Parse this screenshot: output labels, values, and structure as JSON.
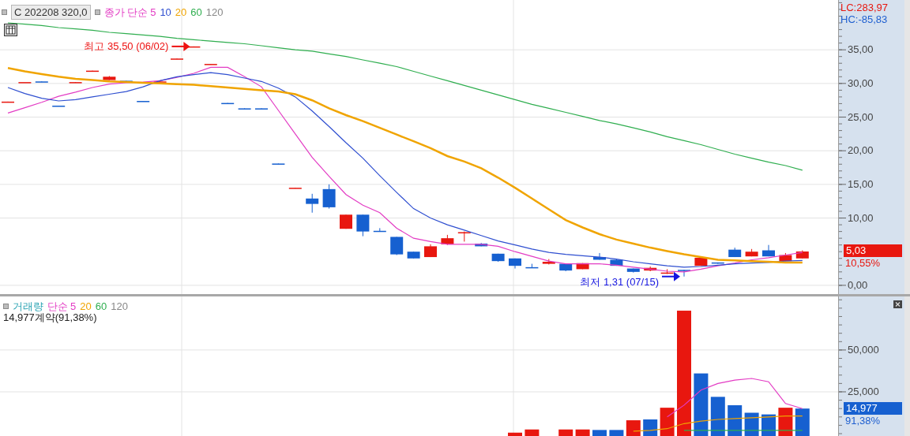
{
  "price_panel": {
    "symbol_box": "C 202208 320,0",
    "legend_prefix": "종가 단순",
    "legend_extra": "120",
    "lc": "LC:283,97",
    "hc": "HC:-85,83",
    "current_price_tag": "5,03",
    "current_change": "10,55%",
    "chart_data": {
      "type": "candlestick",
      "grid": true,
      "ylim": [
        -1.3,
        42.4
      ],
      "yticks": [
        {
          "value": 0,
          "label": "0,00"
        },
        {
          "value": 10,
          "label": "10,00"
        },
        {
          "value": 15,
          "label": "15,00"
        },
        {
          "value": 20,
          "label": "20,00"
        },
        {
          "value": 25,
          "label": "25,00"
        },
        {
          "value": 30,
          "label": "30,00"
        },
        {
          "value": 35,
          "label": "35,00"
        }
      ],
      "series": [
        {
          "name": "5",
          "type": "line",
          "color": "#e33cc4",
          "values": [
            25.6,
            26.4,
            27.2,
            28.1,
            28.7,
            29.4,
            29.9,
            30.1,
            30.2,
            30.4,
            30.9,
            31.5,
            32.4,
            32.4,
            31.0,
            29.5,
            26.0,
            22.5,
            19.0,
            16.2,
            13.5,
            11.9,
            10.8,
            8.5,
            7.0,
            6.5,
            6.1,
            6.1,
            6.1,
            5.8,
            5.0,
            4.3,
            3.6,
            3.2,
            3.2,
            3.2,
            3.0,
            2.7,
            2.4,
            2.1,
            2.0,
            2.4,
            2.9,
            3.3,
            3.8,
            4.1,
            4.5,
            4.9
          ]
        },
        {
          "name": "10",
          "type": "line",
          "color": "#2f4fd0",
          "values": [
            29.4,
            28.5,
            27.8,
            27.4,
            27.6,
            28.0,
            28.4,
            28.8,
            29.5,
            30.4,
            31.0,
            31.3,
            31.6,
            31.3,
            30.8,
            30.3,
            29.3,
            28.0,
            25.9,
            23.6,
            21.2,
            18.9,
            16.3,
            13.8,
            11.4,
            10.0,
            9.0,
            8.2,
            7.4,
            6.6,
            6.0,
            5.4,
            4.9,
            4.6,
            4.4,
            4.2,
            3.9,
            3.5,
            3.2,
            2.9,
            2.7,
            2.8,
            3.0,
            3.2,
            3.3,
            3.4,
            3.6,
            3.7
          ]
        },
        {
          "name": "20",
          "type": "line",
          "color": "#f0a400",
          "values": [
            32.3,
            31.8,
            31.4,
            31.0,
            30.7,
            30.5,
            30.3,
            30.2,
            30.1,
            30.0,
            29.9,
            29.8,
            29.6,
            29.4,
            29.2,
            29.0,
            28.8,
            28.4,
            27.5,
            26.3,
            25.3,
            24.4,
            23.4,
            22.4,
            21.4,
            20.4,
            19.2,
            18.4,
            17.4,
            16.0,
            14.5,
            12.9,
            11.3,
            9.7,
            8.6,
            7.6,
            6.8,
            6.2,
            5.6,
            5.1,
            4.6,
            4.2,
            3.8,
            3.7,
            3.6,
            3.5,
            3.4,
            3.4
          ]
        },
        {
          "name": "60",
          "type": "line",
          "color": "#2fae4f",
          "values": [
            39.0,
            38.8,
            38.6,
            38.3,
            38.1,
            37.9,
            37.6,
            37.4,
            37.2,
            37.0,
            36.7,
            36.5,
            36.3,
            36.1,
            35.9,
            35.6,
            35.3,
            35.0,
            34.8,
            34.4,
            34.0,
            33.5,
            33.0,
            32.5,
            31.8,
            31.1,
            30.4,
            29.7,
            29.0,
            28.3,
            27.6,
            26.9,
            26.3,
            25.7,
            25.1,
            24.5,
            24.0,
            23.4,
            22.8,
            22.1,
            21.5,
            20.9,
            20.2,
            19.5,
            18.9,
            18.3,
            17.8,
            17.1
          ]
        }
      ],
      "ohlc": [
        [
          27.2,
          27.3,
          27.2,
          27.3
        ],
        [
          30.2,
          30.2,
          30.2,
          30.2
        ],
        [
          30.3,
          30.3,
          30.2,
          30.2
        ],
        [
          26.7,
          26.7,
          26.6,
          26.6
        ],
        [
          30.1,
          30.2,
          30.1,
          30.2
        ],
        [
          31.8,
          31.9,
          31.8,
          31.9
        ],
        [
          30.5,
          31.1,
          30.5,
          31.0
        ],
        [
          30.4,
          30.4,
          30.3,
          30.3
        ],
        [
          27.4,
          27.4,
          27.3,
          27.3
        ],
        [
          30.2,
          30.3,
          30.2,
          30.3
        ],
        [
          33.6,
          33.7,
          33.6,
          33.7
        ],
        [
          35.4,
          35.5,
          35.4,
          35.5
        ],
        [
          32.8,
          32.9,
          32.8,
          32.9
        ],
        [
          27.1,
          27.1,
          27.0,
          27.0
        ],
        [
          26.3,
          26.3,
          26.2,
          26.2
        ],
        [
          26.3,
          26.3,
          26.2,
          26.2
        ],
        [
          18.1,
          18.1,
          18.0,
          18.0
        ],
        [
          14.4,
          14.5,
          14.4,
          14.5
        ],
        [
          12.9,
          13.6,
          10.8,
          12.1
        ],
        [
          14.3,
          15.0,
          11.4,
          11.6
        ],
        [
          8.4,
          10.5,
          8.4,
          10.5
        ],
        [
          10.5,
          10.5,
          7.3,
          8.0
        ],
        [
          8.1,
          8.5,
          8.0,
          8.0
        ],
        [
          7.2,
          7.2,
          4.5,
          4.6
        ],
        [
          5.0,
          5.0,
          4.0,
          4.0
        ],
        [
          4.2,
          6.1,
          4.2,
          5.8
        ],
        [
          6.1,
          7.5,
          6.0,
          7.0
        ],
        [
          7.8,
          8.0,
          6.5,
          7.9
        ],
        [
          6.2,
          6.3,
          5.8,
          5.8
        ],
        [
          4.7,
          4.7,
          3.5,
          3.6
        ],
        [
          4.0,
          4.0,
          2.5,
          2.9
        ],
        [
          2.7,
          3.2,
          2.6,
          2.6
        ],
        [
          3.2,
          3.9,
          3.1,
          3.5
        ],
        [
          3.2,
          3.2,
          2.1,
          2.2
        ],
        [
          2.4,
          3.3,
          2.4,
          3.3
        ],
        [
          4.2,
          4.8,
          3.8,
          3.8
        ],
        [
          3.8,
          3.9,
          2.9,
          2.9
        ],
        [
          2.5,
          2.5,
          1.9,
          2.0
        ],
        [
          2.2,
          2.8,
          2.1,
          2.6
        ],
        [
          1.8,
          2.4,
          1.7,
          1.9
        ],
        [
          2.3,
          2.3,
          1.31,
          2.2
        ],
        [
          2.9,
          4.2,
          2.9,
          4.1
        ],
        [
          3.4,
          3.4,
          3.2,
          3.3
        ],
        [
          5.3,
          5.6,
          4.2,
          4.2
        ],
        [
          4.3,
          5.4,
          4.3,
          5.0
        ],
        [
          5.2,
          6.0,
          4.3,
          4.3
        ],
        [
          3.6,
          4.8,
          3.6,
          4.5
        ],
        [
          4.0,
          5.2,
          4.0,
          5.03
        ]
      ],
      "annotations": [
        "최고 35,50 (06/02)",
        "최저 1,31 (07/15)"
      ]
    }
  },
  "volume_panel": {
    "title": "거래량",
    "legend_prefix": "단순",
    "legend_extra": "120",
    "summary": "14,977계약(91,38%)",
    "current_volume_tag": "14,977",
    "current_ratio": "91,38%",
    "chart_data": {
      "type": "bar",
      "grid": true,
      "stacked": false,
      "ylim": [
        -1400,
        82000
      ],
      "yticks": [
        {
          "value": 25000,
          "label": "25,000"
        },
        {
          "value": 50000,
          "label": "50,000"
        }
      ],
      "series": [
        {
          "type": "bar",
          "color": "#e8170f",
          "values": [
            null,
            null,
            null,
            null,
            null,
            null,
            null,
            null,
            null,
            null,
            null,
            null,
            null,
            null,
            null,
            null,
            null,
            null,
            null,
            null,
            null,
            null,
            null,
            null,
            null,
            null,
            null,
            null,
            null,
            null,
            600,
            2500,
            null,
            2500,
            2500,
            null,
            null,
            8000,
            null,
            15500,
            73500,
            null,
            null,
            null,
            null,
            null,
            15500,
            null
          ]
        },
        {
          "type": "bar",
          "color": "#1660d0",
          "values": [
            null,
            null,
            null,
            null,
            null,
            null,
            null,
            null,
            null,
            null,
            null,
            null,
            null,
            null,
            null,
            null,
            null,
            null,
            null,
            null,
            null,
            null,
            null,
            null,
            null,
            null,
            null,
            null,
            null,
            null,
            null,
            null,
            null,
            null,
            null,
            2200,
            2200,
            null,
            8500,
            null,
            null,
            36000,
            22000,
            17000,
            12500,
            11500,
            null,
            15000
          ]
        },
        {
          "name": "5",
          "type": "line",
          "color": "#e33cc4",
          "values": [
            null,
            null,
            null,
            null,
            null,
            null,
            null,
            null,
            null,
            null,
            null,
            null,
            null,
            null,
            null,
            null,
            null,
            null,
            null,
            null,
            null,
            null,
            null,
            null,
            null,
            null,
            null,
            null,
            null,
            null,
            null,
            null,
            null,
            null,
            null,
            null,
            null,
            null,
            null,
            10000,
            17000,
            26000,
            30000,
            32000,
            33000,
            31000,
            18000,
            15000
          ]
        },
        {
          "name": "20",
          "type": "line",
          "color": "#f0a400",
          "values": [
            null,
            null,
            null,
            null,
            null,
            null,
            null,
            null,
            null,
            null,
            null,
            null,
            null,
            null,
            null,
            null,
            null,
            null,
            null,
            null,
            null,
            null,
            null,
            null,
            null,
            null,
            null,
            null,
            null,
            null,
            null,
            null,
            null,
            null,
            null,
            null,
            null,
            1500,
            2000,
            3000,
            6000,
            7500,
            8500,
            9000,
            9500,
            10000,
            10500,
            10500
          ]
        },
        {
          "name": "60",
          "type": "line",
          "color": "#2fae4f",
          "values": [
            null,
            null,
            null,
            null,
            null,
            null,
            null,
            null,
            null,
            null,
            null,
            null,
            null,
            null,
            null,
            null,
            null,
            null,
            null,
            null,
            null,
            null,
            null,
            null,
            null,
            null,
            null,
            null,
            null,
            null,
            null,
            null,
            null,
            null,
            null,
            null,
            null,
            null,
            null,
            null,
            2000,
            2000,
            2000,
            2000,
            2000,
            2000,
            2000,
            2000
          ]
        }
      ]
    }
  }
}
